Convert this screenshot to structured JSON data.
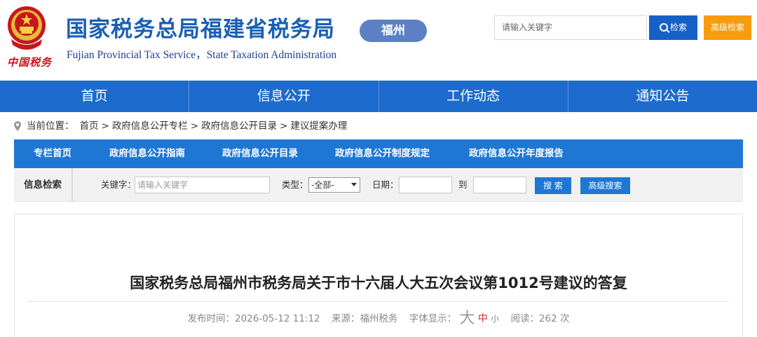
{
  "header": {
    "logo_text": "中国税务",
    "title": "国家税务总局福建省税务局",
    "subtitle": "Fujian Provincial Tax Service，State Taxation Administration",
    "city": "福州",
    "search_placeholder": "请输入关键字",
    "search_label": "检索",
    "advanced_label": "高级检索"
  },
  "main_nav": [
    "首页",
    "信息公开",
    "工作动态",
    "通知公告"
  ],
  "breadcrumb": {
    "prefix": "当前位置：",
    "items": [
      "首页",
      "政府信息公开专栏",
      "政府信息公开目录",
      "建议提案办理"
    ],
    "separator": ">"
  },
  "sub_nav": [
    "专栏首页",
    "政府信息公开指南",
    "政府信息公开目录",
    "政府信息公开制度规定",
    "政府信息公开年度报告"
  ],
  "info_search": {
    "title": "信息检索",
    "keyword_label": "关键字：",
    "keyword_placeholder": "请输入关键字",
    "type_label": "类型：",
    "type_value": "-全部-",
    "date_label": "日期：",
    "to_label": "到",
    "search_label": "搜 索",
    "advanced_label": "高级搜索"
  },
  "article": {
    "title": "国家税务总局福州市税务局关于市十六届人大五次会议第1012号建议的答复",
    "publish_label": "发布时间：",
    "publish_time": "2026-05-12 11:12",
    "source_label": "来源：",
    "source": "福州税务",
    "font_label": "字体显示：",
    "font_big": "大",
    "font_mid": "中",
    "font_small": "小",
    "read_label": "阅读：",
    "read_count": "262 次"
  },
  "colors": {
    "brand_blue": "#1a5fb4",
    "nav_blue": "#1d6bcc",
    "subnav_blue": "#1f77d4",
    "orange": "#f79c0f",
    "red": "#c8161d"
  }
}
